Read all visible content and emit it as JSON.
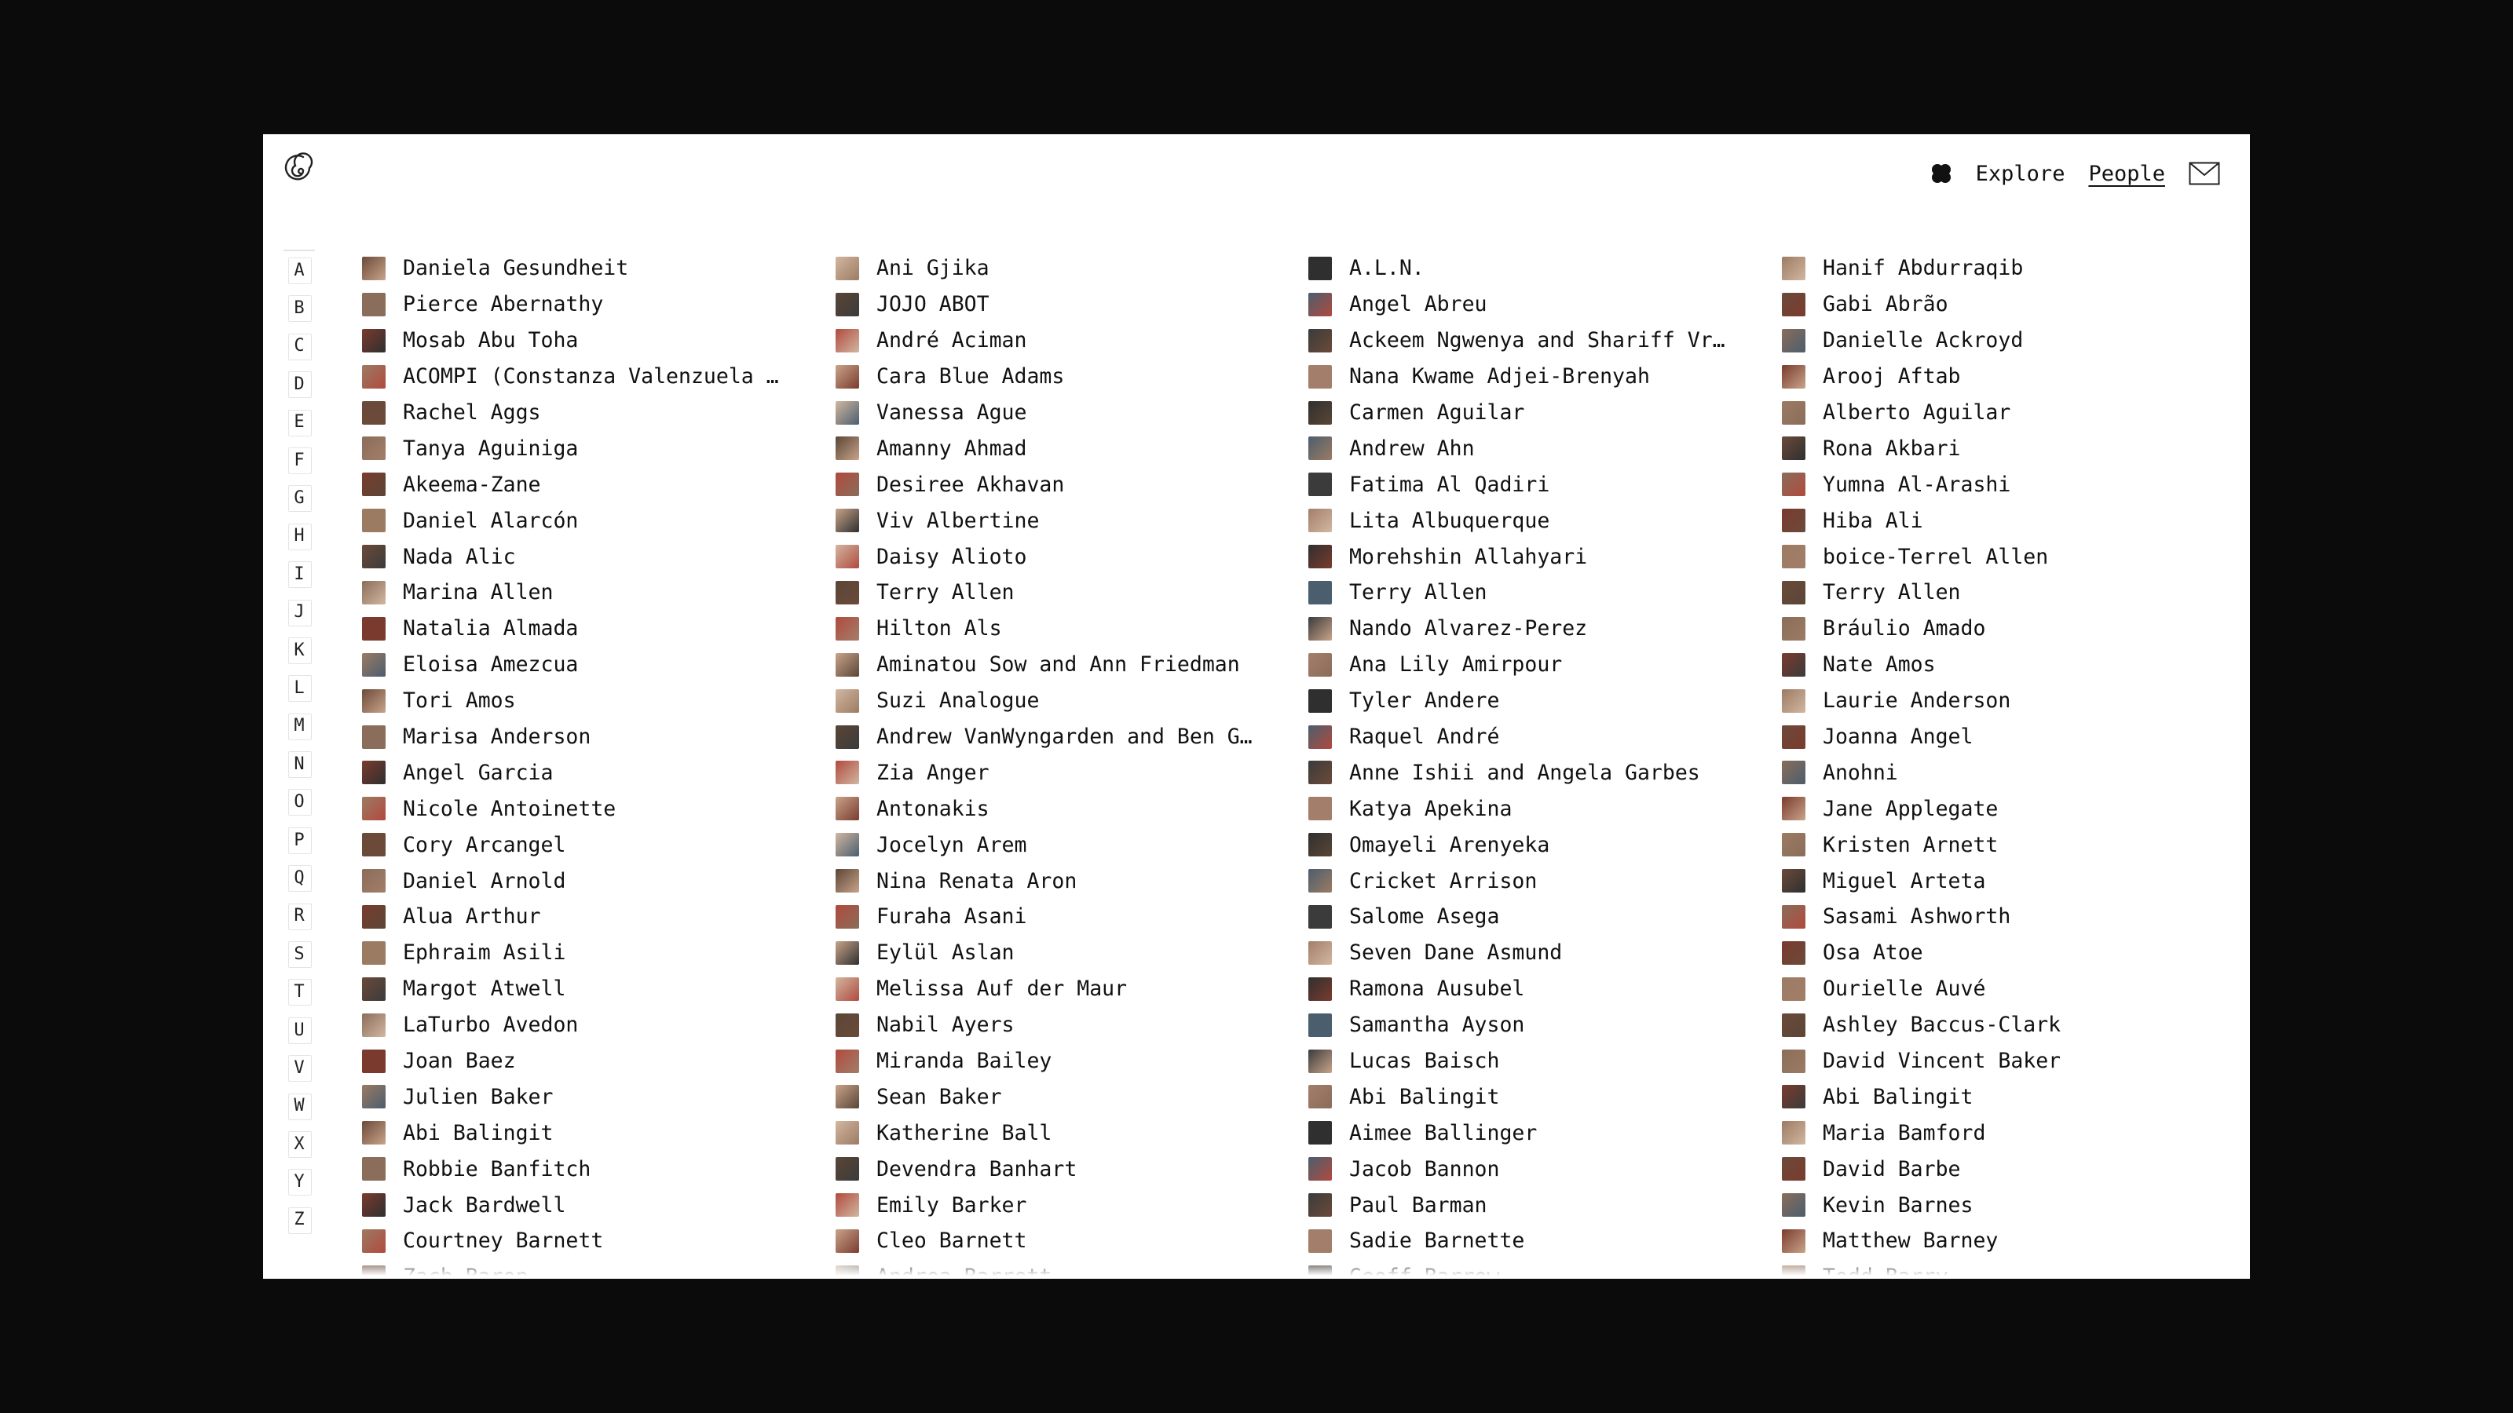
{
  "nav": {
    "explore_label": "Explore",
    "people_label": "People",
    "icons": [
      "spiral-logo-icon",
      "flower-icon",
      "mail-icon"
    ]
  },
  "alphabet": [
    "A",
    "B",
    "C",
    "D",
    "E",
    "F",
    "G",
    "H",
    "I",
    "J",
    "K",
    "L",
    "M",
    "N",
    "O",
    "P",
    "Q",
    "R",
    "S",
    "T",
    "U",
    "V",
    "W",
    "X",
    "Y",
    "Z"
  ],
  "avatar_colors": [
    "#6b4a3a",
    "#b04a3e",
    "#2f2f2f",
    "#8a6d5a",
    "#c9a48a",
    "#4b5e6e",
    "#7a3b2e",
    "#d2b7a1",
    "#3b3b3b",
    "#9c7b63",
    "#5a4636",
    "#a37e6a"
  ],
  "columns": [
    [
      "Daniela Gesundheit",
      "Pierce Abernathy",
      "Mosab Abu Toha",
      "ACOMPI (Constanza Valenzuela …",
      "Rachel Aggs",
      "Tanya Aguiniga",
      "Akeema-Zane",
      "Daniel Alarcón",
      "Nada Alic",
      "Marina Allen",
      "Natalia Almada",
      "Eloisa Amezcua",
      "Tori Amos",
      "Marisa Anderson",
      "Angel Garcia",
      "Nicole Antoinette",
      "Cory Arcangel",
      "Daniel Arnold",
      "Alua Arthur",
      "Ephraim Asili",
      "Margot Atwell",
      "LaTurbo Avedon",
      "Joan Baez",
      "Julien Baker",
      "Abi Balingit",
      "Robbie Banfitch",
      "Jack Bardwell",
      "Courtney Barnett",
      "Zach Baron"
    ],
    [
      "Ani Gjika",
      "JOJO ABOT",
      "André Aciman",
      "Cara Blue Adams",
      "Vanessa Ague",
      "Amanny Ahmad",
      "Desiree Akhavan",
      "Viv Albertine",
      "Daisy Alioto",
      "Terry Allen",
      "Hilton Als",
      "Aminatou Sow and Ann Friedman",
      "Suzi Analogue",
      "Andrew VanWyngarden and Ben G…",
      "Zia Anger",
      "Antonakis",
      "Jocelyn Arem",
      "Nina Renata Aron",
      "Furaha Asani",
      "Eylül Aslan",
      "Melissa Auf der Maur",
      "Nabil Ayers",
      "Miranda Bailey",
      "Sean Baker",
      "Katherine Ball",
      "Devendra Banhart",
      "Emily Barker",
      "Cleo Barnett",
      "Andrea Barrett"
    ],
    [
      "A.L.N.",
      "Angel Abreu",
      "Ackeem Ngwenya and Shariff Vr…",
      "Nana Kwame Adjei-Brenyah",
      "Carmen Aguilar",
      "Andrew Ahn",
      "Fatima Al Qadiri",
      "Lita Albuquerque",
      "Morehshin Allahyari",
      "Terry Allen",
      "Nando Alvarez-Perez",
      "Ana Lily Amirpour",
      "Tyler Andere",
      "Raquel André",
      "Anne Ishii and Angela Garbes",
      "Katya Apekina",
      "Omayeli Arenyeka",
      "Cricket Arrison",
      "Salome Asega",
      "Seven Dane Asmund",
      "Ramona Ausubel",
      "Samantha Ayson",
      "Lucas Baisch",
      "Abi Balingit",
      "Aimee Ballinger",
      "Jacob Bannon",
      "Paul Barman",
      "Sadie Barnette",
      "Geoff Barrow"
    ],
    [
      "Hanif Abdurraqib",
      "Gabi Abrão",
      "Danielle Ackroyd",
      "Arooj Aftab",
      "Alberto Aguilar",
      "Rona Akbari",
      "Yumna Al-Arashi",
      "Hiba Ali",
      "boice-Terrel Allen",
      "Terry Allen",
      "Bráulio Amado",
      "Nate Amos",
      "Laurie Anderson",
      "Joanna Angel",
      "Anohni",
      "Jane Applegate",
      "Kristen Arnett",
      "Miguel Arteta",
      "Sasami Ashworth",
      "Osa Atoe",
      "Ourielle Auvé",
      "Ashley Baccus-Clark",
      "David Vincent Baker",
      "Abi Balingit",
      "Maria Bamford",
      "David Barbe",
      "Kevin Barnes",
      "Matthew Barney",
      "Todd Barry"
    ]
  ]
}
